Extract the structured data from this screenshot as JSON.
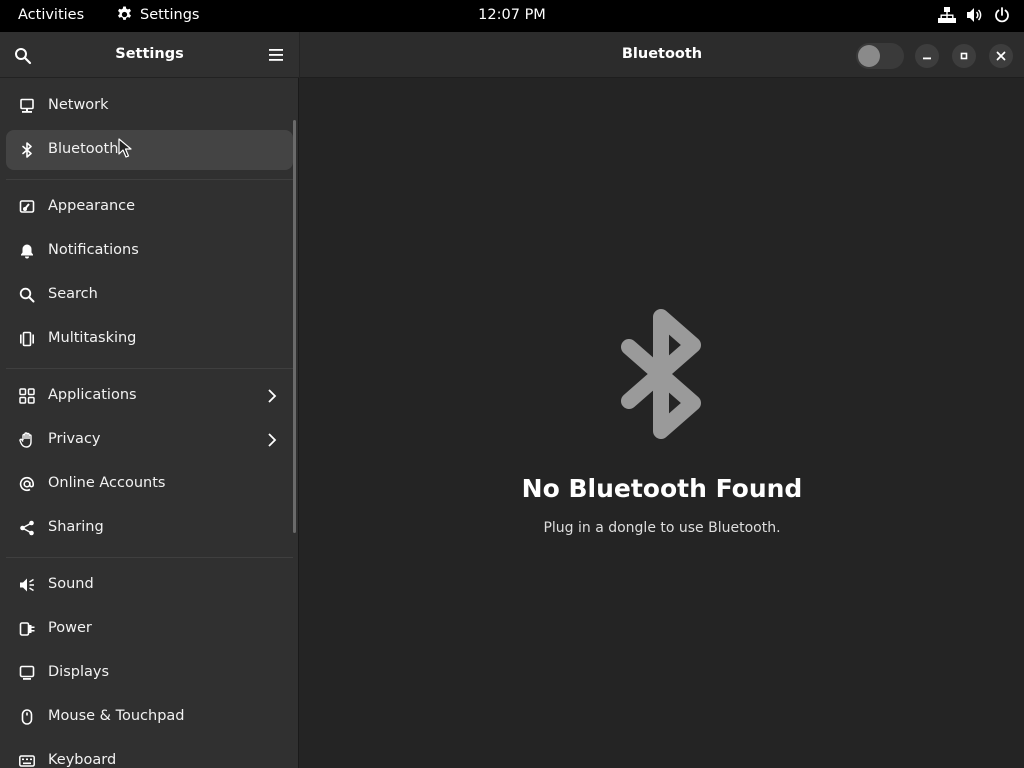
{
  "topbar": {
    "activities": "Activities",
    "app_name": "Settings",
    "clock": "12:07 PM",
    "icons": [
      "network-icon",
      "volume-icon",
      "power-icon"
    ]
  },
  "sidebar": {
    "title": "Settings",
    "items": [
      {
        "label": "Network",
        "icon": "network-icon"
      },
      {
        "label": "Bluetooth",
        "icon": "bluetooth-icon",
        "active": true
      },
      {
        "label": "Appearance",
        "icon": "appearance-icon"
      },
      {
        "label": "Notifications",
        "icon": "bell-icon"
      },
      {
        "label": "Search",
        "icon": "search-icon"
      },
      {
        "label": "Multitasking",
        "icon": "multitasking-icon"
      },
      {
        "label": "Applications",
        "icon": "applications-icon",
        "has_submenu": true
      },
      {
        "label": "Privacy",
        "icon": "hand-icon",
        "has_submenu": true
      },
      {
        "label": "Online Accounts",
        "icon": "at-icon"
      },
      {
        "label": "Sharing",
        "icon": "share-icon"
      },
      {
        "label": "Sound",
        "icon": "speaker-icon"
      },
      {
        "label": "Power",
        "icon": "power-plug-icon"
      },
      {
        "label": "Displays",
        "icon": "display-icon"
      },
      {
        "label": "Mouse & Touchpad",
        "icon": "mouse-icon"
      },
      {
        "label": "Keyboard",
        "icon": "keyboard-icon"
      }
    ]
  },
  "main": {
    "title": "Bluetooth",
    "toggle_on": false,
    "empty_title": "No Bluetooth Found",
    "empty_subtitle": "Plug in a dongle to use Bluetooth."
  },
  "colors": {
    "topbar_bg": "#000000",
    "sidebar_bg": "#303030",
    "content_bg": "#242424",
    "active_item_bg": "#444444",
    "icon_gray": "#9a9a9a"
  }
}
